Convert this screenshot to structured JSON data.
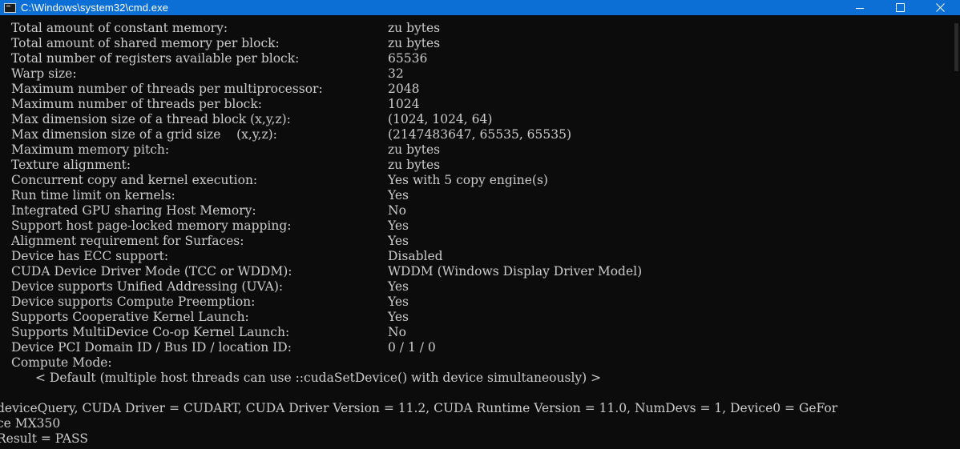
{
  "window": {
    "title": "C:\\Windows\\system32\\cmd.exe",
    "controls": {
      "minimize": "minimize-icon",
      "maximize": "maximize-icon",
      "close": "close-icon"
    }
  },
  "console": {
    "properties": [
      {
        "label": "Total amount of constant memory:",
        "value": "zu bytes"
      },
      {
        "label": "Total amount of shared memory per block:",
        "value": "zu bytes"
      },
      {
        "label": "Total number of registers available per block:",
        "value": "65536"
      },
      {
        "label": "Warp size:",
        "value": "32"
      },
      {
        "label": "Maximum number of threads per multiprocessor:",
        "value": "2048"
      },
      {
        "label": "Maximum number of threads per block:",
        "value": "1024"
      },
      {
        "label": "Max dimension size of a thread block (x,y,z):",
        "value": "(1024, 1024, 64)"
      },
      {
        "label": "Max dimension size of a grid size    (x,y,z):",
        "value": "(2147483647, 65535, 65535)"
      },
      {
        "label": "Maximum memory pitch:",
        "value": "zu bytes"
      },
      {
        "label": "Texture alignment:",
        "value": "zu bytes"
      },
      {
        "label": "Concurrent copy and kernel execution:",
        "value": "Yes with 5 copy engine(s)"
      },
      {
        "label": "Run time limit on kernels:",
        "value": "Yes"
      },
      {
        "label": "Integrated GPU sharing Host Memory:",
        "value": "No"
      },
      {
        "label": "Support host page-locked memory mapping:",
        "value": "Yes"
      },
      {
        "label": "Alignment requirement for Surfaces:",
        "value": "Yes"
      },
      {
        "label": "Device has ECC support:",
        "value": "Disabled"
      },
      {
        "label": "CUDA Device Driver Mode (TCC or WDDM):",
        "value": "WDDM (Windows Display Driver Model)"
      },
      {
        "label": "Device supports Unified Addressing (UVA):",
        "value": "Yes"
      },
      {
        "label": "Device supports Compute Preemption:",
        "value": "Yes"
      },
      {
        "label": "Supports Cooperative Kernel Launch:",
        "value": "Yes"
      },
      {
        "label": "Supports MultiDevice Co-op Kernel Launch:",
        "value": "No"
      },
      {
        "label": "Device PCI Domain ID / Bus ID / location ID:",
        "value": "0 / 1 / 0"
      }
    ],
    "compute_mode_label": "Compute Mode:",
    "compute_mode_value": "< Default (multiple host threads can use ::cudaSetDevice() with device simultaneously) >",
    "summary_line_1": "deviceQuery, CUDA Driver = CUDART, CUDA Driver Version = 11.2, CUDA Runtime Version = 11.0, NumDevs = 1, Device0 = GeFor",
    "summary_line_2": "ce MX350",
    "result_line": "Result = PASS"
  },
  "colors": {
    "titlebar": "#0b6fd6",
    "console_bg": "#0c0c0c",
    "console_text": "#cccccc"
  }
}
